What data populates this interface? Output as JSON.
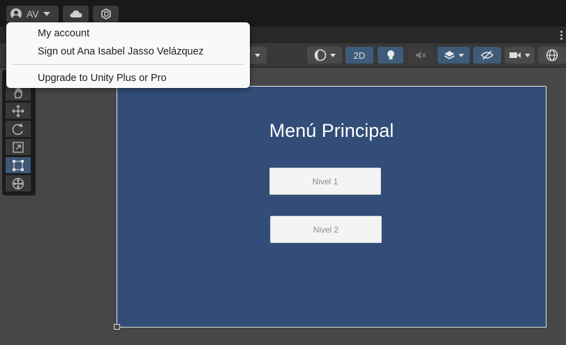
{
  "account": {
    "initials": "AV"
  },
  "account_menu": {
    "items": [
      {
        "label": "My account"
      },
      {
        "label": "Sign out Ana Isabel Jasso Velázquez"
      },
      {
        "label": "Upgrade to Unity Plus or Pro"
      }
    ]
  },
  "toolbar": {
    "two_d_label": "2D"
  },
  "tools": [
    "hand-tool",
    "move-tool",
    "rotate-tool",
    "scale-tool",
    "rect-tool",
    "transform-tool"
  ],
  "active_tool": "rect-tool",
  "scene": {
    "title": "Menú Principal",
    "buttons": [
      {
        "label": "Nivel 1"
      },
      {
        "label": "Nivel 2"
      }
    ],
    "canvas_color": "#334d79"
  }
}
